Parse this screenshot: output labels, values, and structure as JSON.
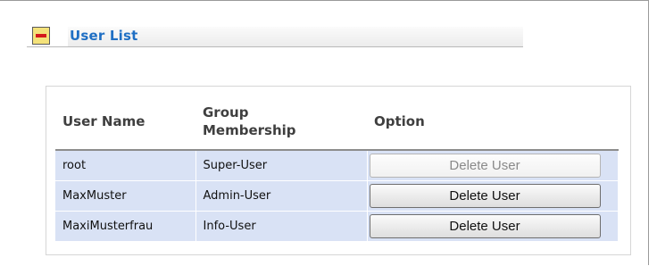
{
  "section": {
    "title": "User List",
    "collapse_icon": "minus-icon"
  },
  "table": {
    "headers": {
      "user_name": "User Name",
      "group_line1": "Group",
      "group_line2": "Membership",
      "option": "Option"
    },
    "rows": [
      {
        "user": "root",
        "group": "Super-User",
        "action": "Delete User",
        "enabled": false
      },
      {
        "user": "MaxMuster",
        "group": "Admin-User",
        "action": "Delete User",
        "enabled": true
      },
      {
        "user": "MaxiMusterfrau",
        "group": "Info-User",
        "action": "Delete User",
        "enabled": true
      }
    ]
  },
  "colors": {
    "title": "#1f6fc4",
    "row_background": "#d9e2f5",
    "collapse_icon_fill": "#f4e27a",
    "collapse_icon_bar": "#d4191c"
  }
}
